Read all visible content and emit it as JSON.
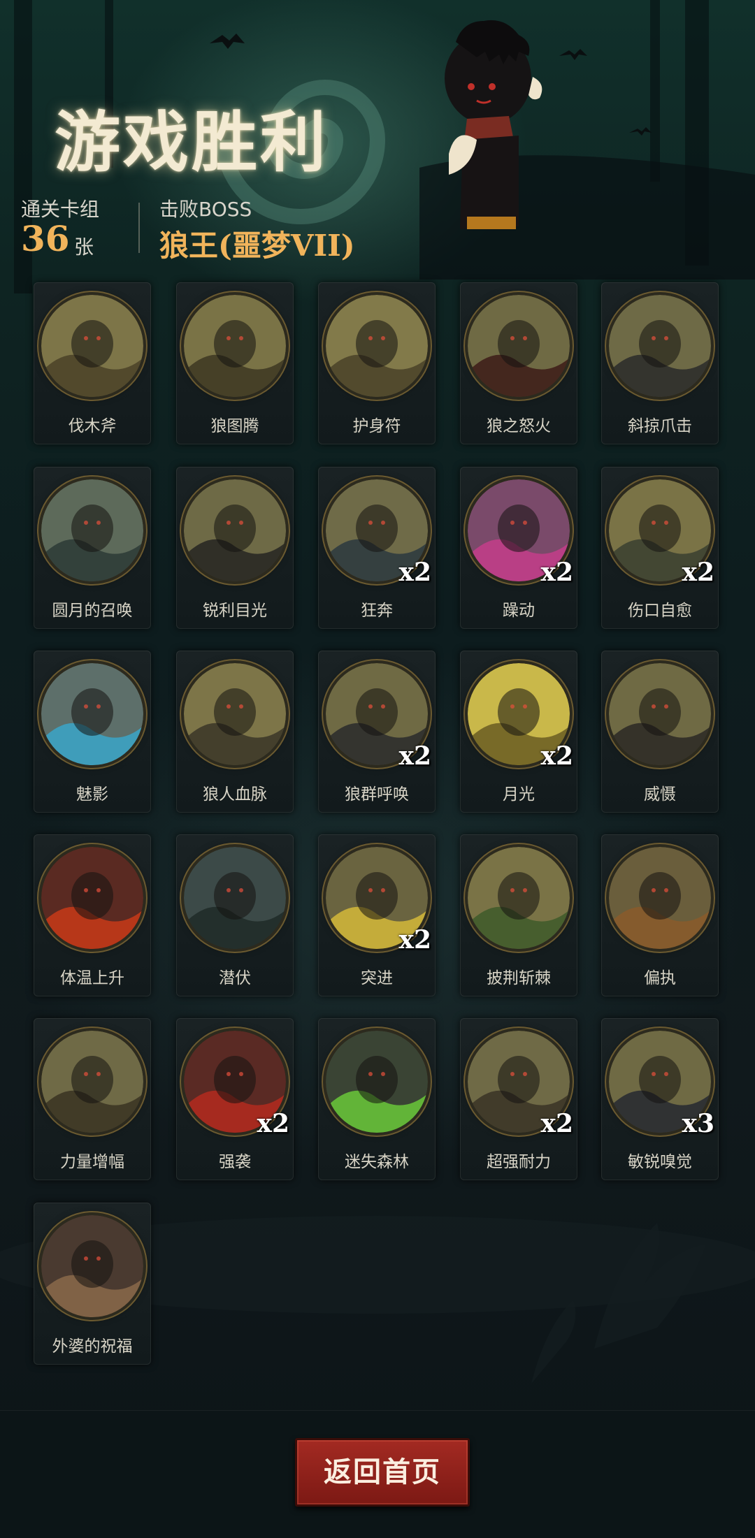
{
  "header": {
    "title": "游戏胜利",
    "deck_label": "通关卡组",
    "deck_count": "36",
    "deck_unit": "张",
    "boss_label": "击败BOSS",
    "boss_name": "狼王(噩梦VII)"
  },
  "cards": [
    {
      "label": "伐木斧",
      "icon": "axe-icon",
      "count": ""
    },
    {
      "label": "狼图腾",
      "icon": "wolf-totem-icon",
      "count": ""
    },
    {
      "label": "护身符",
      "icon": "amulet-icon",
      "count": ""
    },
    {
      "label": "狼之怒火",
      "icon": "wolf-rage-icon",
      "count": ""
    },
    {
      "label": "斜掠爪击",
      "icon": "claw-strike-icon",
      "count": ""
    },
    {
      "label": "圆月的召唤",
      "icon": "full-moon-icon",
      "count": ""
    },
    {
      "label": "锐利目光",
      "icon": "sharp-eyes-icon",
      "count": ""
    },
    {
      "label": "狂奔",
      "icon": "sprint-icon",
      "count": "x2"
    },
    {
      "label": "躁动",
      "icon": "frenzy-icon",
      "count": "x2"
    },
    {
      "label": "伤口自愈",
      "icon": "self-heal-icon",
      "count": "x2"
    },
    {
      "label": "魅影",
      "icon": "phantom-icon",
      "count": ""
    },
    {
      "label": "狼人血脉",
      "icon": "werewolf-blood-icon",
      "count": ""
    },
    {
      "label": "狼群呼唤",
      "icon": "pack-call-icon",
      "count": "x2"
    },
    {
      "label": "月光",
      "icon": "moonlight-icon",
      "count": "x2"
    },
    {
      "label": "威慑",
      "icon": "intimidate-icon",
      "count": ""
    },
    {
      "label": "体温上升",
      "icon": "heat-rise-icon",
      "count": ""
    },
    {
      "label": "潜伏",
      "icon": "lurk-icon",
      "count": ""
    },
    {
      "label": "突进",
      "icon": "dash-icon",
      "count": "x2"
    },
    {
      "label": "披荆斩棘",
      "icon": "thorn-cut-icon",
      "count": ""
    },
    {
      "label": "偏执",
      "icon": "paranoia-icon",
      "count": ""
    },
    {
      "label": "力量增幅",
      "icon": "power-boost-icon",
      "count": ""
    },
    {
      "label": "强袭",
      "icon": "assault-icon",
      "count": "x2"
    },
    {
      "label": "迷失森林",
      "icon": "lost-forest-icon",
      "count": ""
    },
    {
      "label": "超强耐力",
      "icon": "endurance-icon",
      "count": "x2"
    },
    {
      "label": "敏锐嗅觉",
      "icon": "keen-smell-icon",
      "count": "x3"
    },
    {
      "label": "外婆的祝福",
      "icon": "grandma-blessing-icon",
      "count": ""
    }
  ],
  "footer": {
    "home_button": "返回首页"
  },
  "colors": {
    "accent_gold": "#f1b45b",
    "button_red": "#a32a22",
    "card_disc": "#7b7346"
  }
}
